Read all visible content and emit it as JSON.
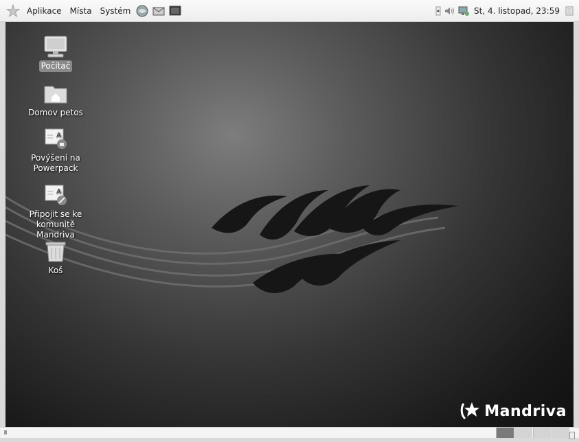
{
  "top_panel": {
    "menus": [
      "Aplikace",
      "Místa",
      "Systém"
    ],
    "clock": "St, 4. listopad, 23:59"
  },
  "desktop": {
    "icons": [
      {
        "label": "Počítač",
        "icon": "computer-icon"
      },
      {
        "label": "Domov petos",
        "icon": "home-folder-icon"
      },
      {
        "label": "Povýšení na Powerpack",
        "icon": "upgrade-icon"
      },
      {
        "label": "Připojit se ke komunitě Mandriva",
        "icon": "community-icon"
      },
      {
        "label": "Koš",
        "icon": "trash-icon"
      }
    ],
    "logo_text": "Mandriva"
  },
  "colors": {
    "panel": "#f0f0f0",
    "desktop_center": "#7d7d7d",
    "desktop_edge": "#111111",
    "selection": "#8a8a8a",
    "active_workspace": "#7a7a7a"
  },
  "bottom_panel": {
    "workspaces": 4,
    "active_workspace": 1
  }
}
